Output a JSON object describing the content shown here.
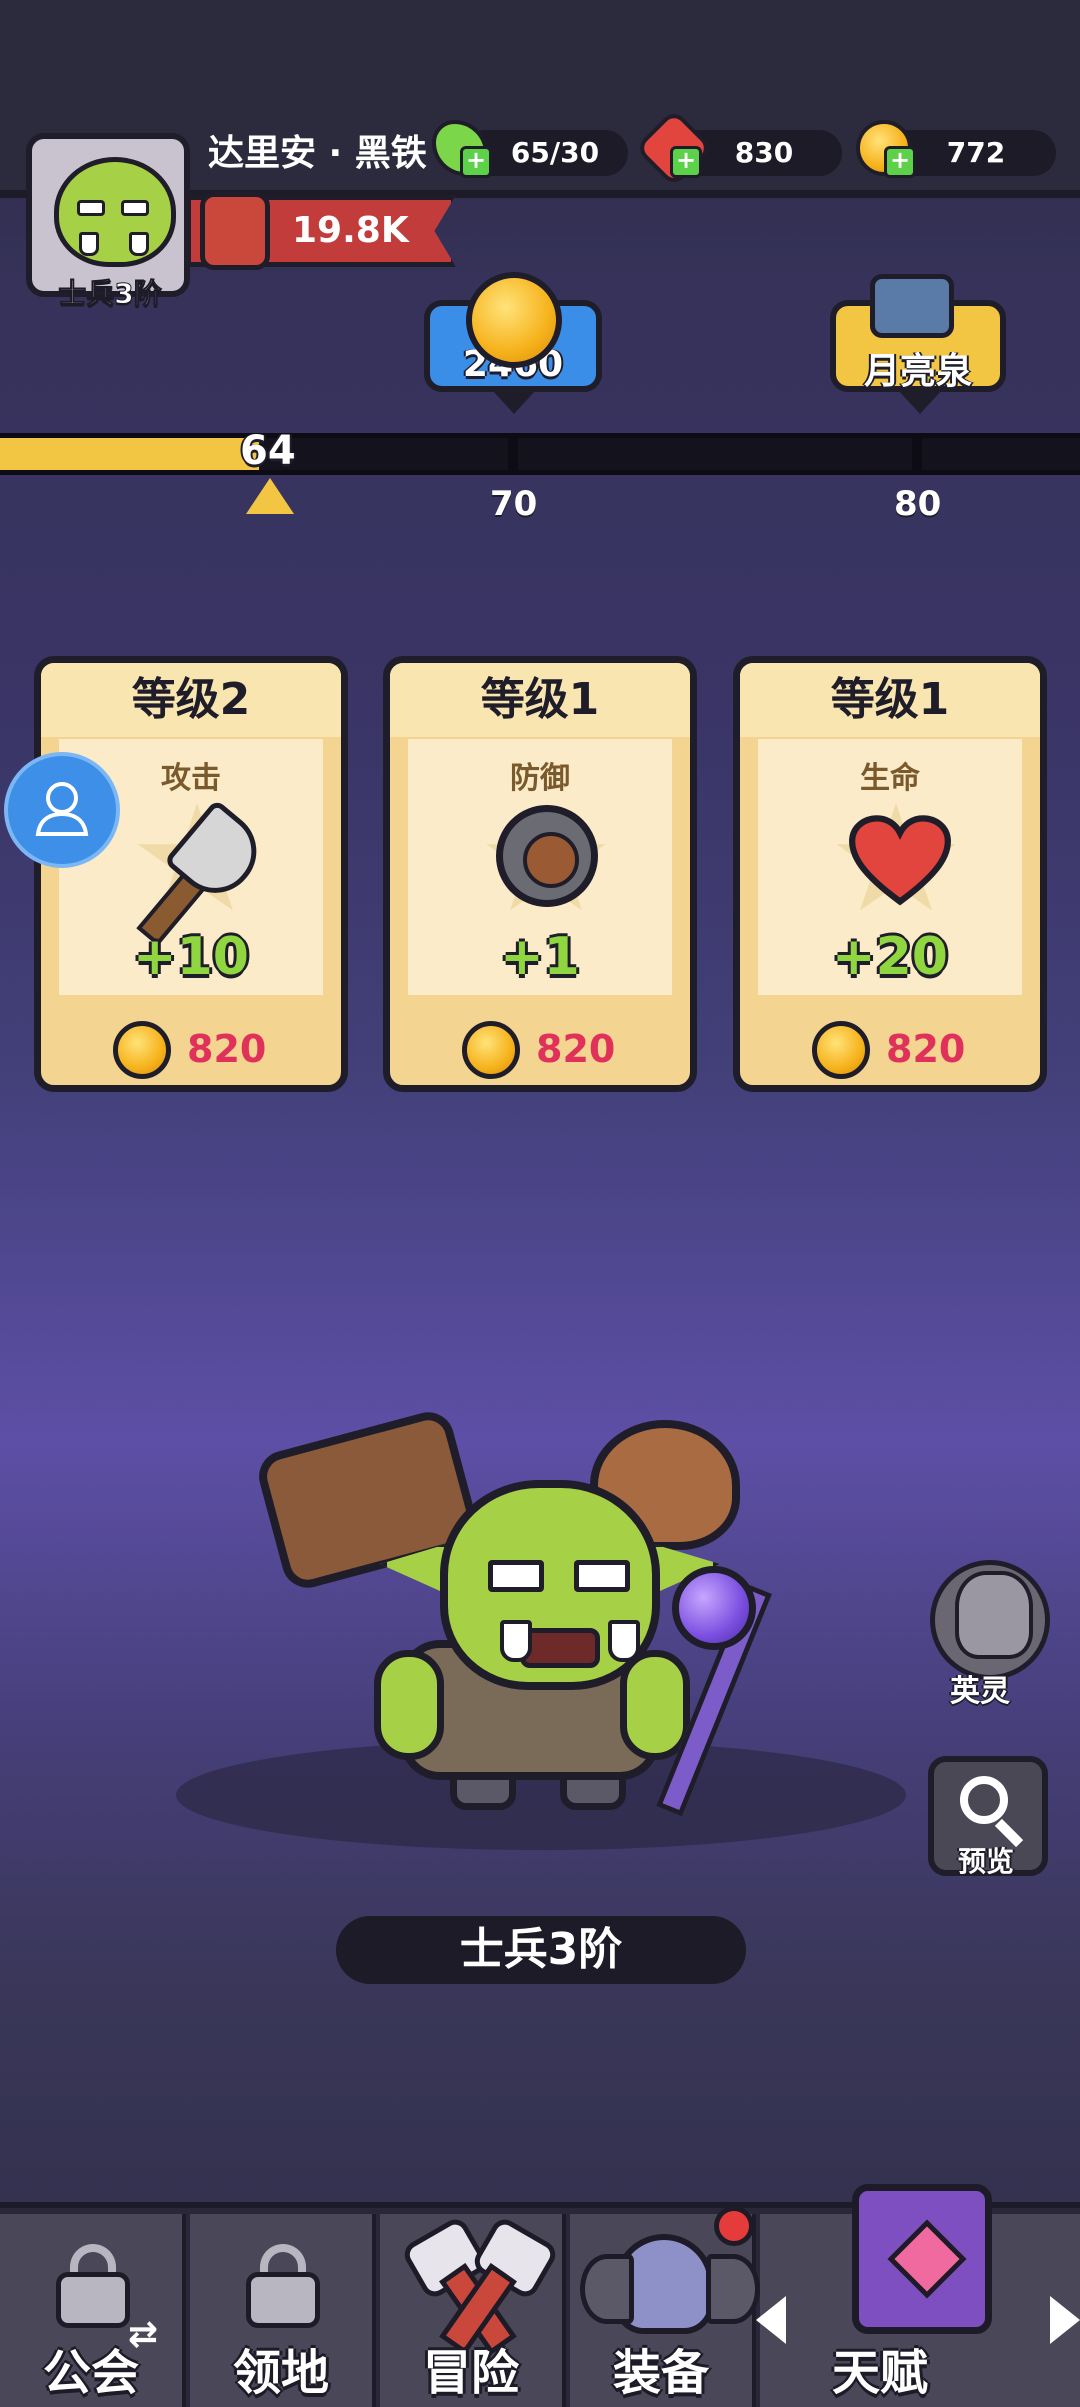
{
  "player": {
    "name": "达里安 · 黑铁",
    "rank_badge": "士兵3阶",
    "power": "19.8K"
  },
  "resources": [
    {
      "icon": "energy-icon",
      "value": "65/30",
      "color": "#7bd64a"
    },
    {
      "icon": "ruby-icon",
      "value": "830",
      "color": "#e2443e"
    },
    {
      "icon": "gold-coin-icon",
      "value": "772",
      "color": "#f6b21b"
    }
  ],
  "milestones": {
    "reward_coin": "2460",
    "reward_spring": "月亮泉"
  },
  "progress": {
    "current": "64",
    "fill_fraction": 0.24,
    "marks": [
      "70",
      "80"
    ]
  },
  "cards": [
    {
      "level": "等级2",
      "stat": "攻击",
      "icon": "axe-icon",
      "bonus": "+10",
      "cost": "820"
    },
    {
      "level": "等级1",
      "stat": "防御",
      "icon": "shield-icon",
      "bonus": "+1",
      "cost": "820"
    },
    {
      "level": "等级1",
      "stat": "生命",
      "icon": "heart-icon",
      "bonus": "+20",
      "cost": "820"
    }
  ],
  "side_buttons": {
    "hero_spirit": "英灵",
    "preview": "预览"
  },
  "character_rank": "士兵3阶",
  "nav": [
    {
      "label": "公会",
      "icon": "lock-icon",
      "locked": true
    },
    {
      "label": "领地",
      "icon": "lock-icon",
      "locked": true
    },
    {
      "label": "冒险",
      "icon": "crossed-axes-icon",
      "locked": false
    },
    {
      "label": "装备",
      "icon": "helmet-icon",
      "locked": false,
      "badge": true
    },
    {
      "label": "天赋",
      "icon": "talent-book-icon",
      "locked": false,
      "active": true
    }
  ]
}
